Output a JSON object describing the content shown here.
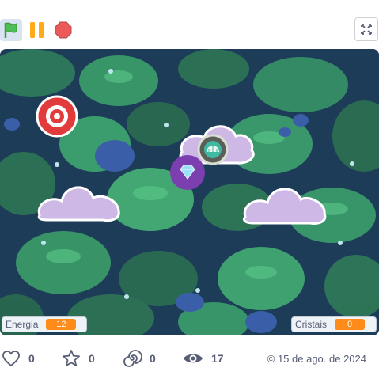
{
  "toolbar": {
    "green_flag": "green-flag-icon",
    "pause": "pause-icon",
    "stop": "stop-icon",
    "fullscreen": "fullscreen-icon"
  },
  "stage": {
    "sprites": [
      "target-icon",
      "cloud",
      "cloud",
      "cloud",
      "orb-icon",
      "gem-icon"
    ]
  },
  "monitors": {
    "energy": {
      "label": "Energia",
      "value": "12"
    },
    "crystals": {
      "label": "Cristais",
      "value": "0"
    }
  },
  "stats": {
    "loves": "0",
    "favorites": "0",
    "remixes": "0",
    "views": "17",
    "date": "© 15 de ago. de 2024"
  },
  "colors": {
    "accent": "#ff8c1a",
    "flag": "#4cbf56",
    "pause": "#ffab19",
    "stop": "#ec5959"
  }
}
